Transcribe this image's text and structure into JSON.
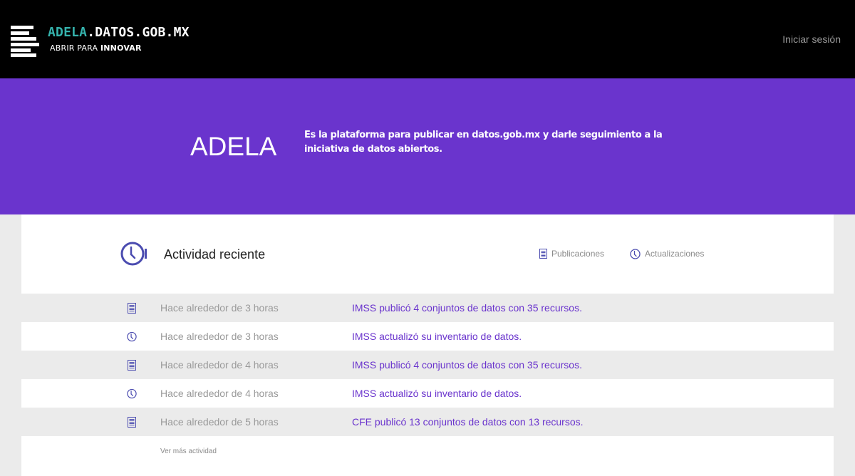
{
  "header": {
    "logo_accent": "ADELA",
    "logo_rest": ".DATOS.GOB.MX",
    "tagline_plain": "ABRIR PARA ",
    "tagline_bold": "INNOVAR",
    "signin_label": "Iniciar sesión"
  },
  "hero": {
    "title": "ADELA",
    "description": "Es la plataforma para publicar en datos.gob.mx y darle seguimiento a la iniciativa de datos abiertos."
  },
  "activity": {
    "title": "Actividad reciente",
    "filters": {
      "publicaciones": "Publicaciones",
      "actualizaciones": "Actualizaciones"
    },
    "items": [
      {
        "type": "document-icon",
        "time": "Hace alrededor de 3 horas",
        "message": "IMSS publicó 4 conjuntos de datos con 35 recursos."
      },
      {
        "type": "clock-icon",
        "time": "Hace alrededor de 3 horas",
        "message": "IMSS actualizó su inventario de datos."
      },
      {
        "type": "document-icon",
        "time": "Hace alrededor de 4 horas",
        "message": "IMSS publicó 4 conjuntos de datos con 35 recursos."
      },
      {
        "type": "clock-icon",
        "time": "Hace alrededor de 4 horas",
        "message": "IMSS actualizó su inventario de datos."
      },
      {
        "type": "document-icon",
        "time": "Hace alrededor de 5 horas",
        "message": "CFE publicó 13 conjuntos de datos con 13 recursos."
      }
    ],
    "more_label": "Ver más actividad"
  },
  "colors": {
    "header_bg": "#000000",
    "accent_teal": "#35b3ad",
    "brand_purple": "#6a34cd",
    "icon_indigo": "#4b4cb0"
  }
}
